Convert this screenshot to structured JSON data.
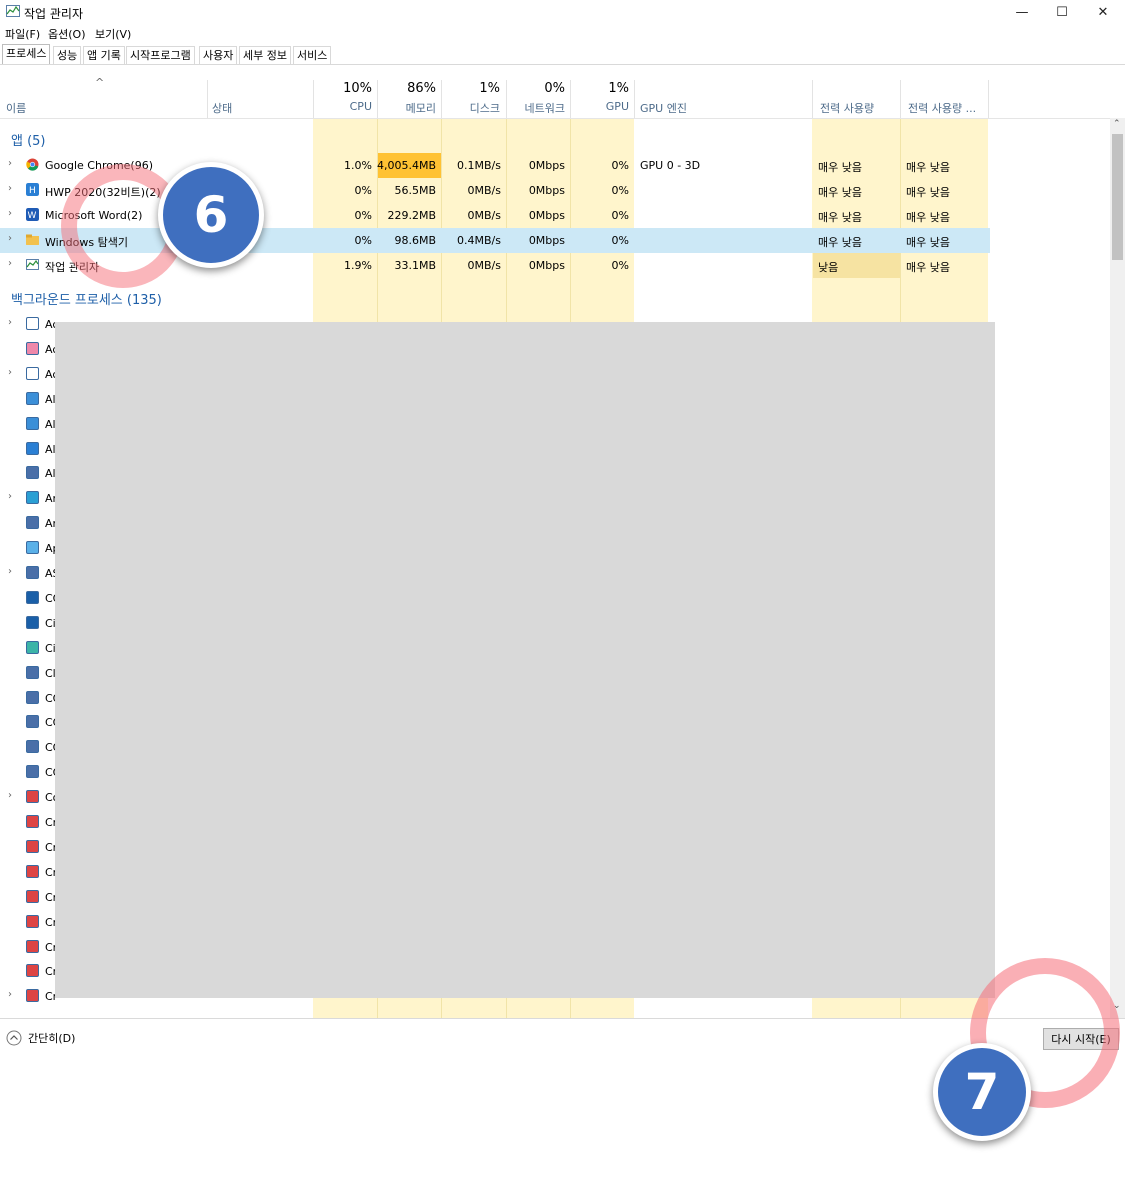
{
  "window": {
    "title": "작업 관리자",
    "minimize": "—",
    "maximize": "☐",
    "close": "✕"
  },
  "menu": [
    "파일(F)",
    "옵션(O)",
    "보기(V)"
  ],
  "tabs": [
    "프로세스",
    "성능",
    "앱 기록",
    "시작프로그램",
    "사용자",
    "세부 정보",
    "서비스"
  ],
  "columns": {
    "sort_arrow": "^",
    "name": "이름",
    "status": "상태",
    "cpu": {
      "pct": "10%",
      "label": "CPU"
    },
    "memory": {
      "pct": "86%",
      "label": "메모리"
    },
    "disk": {
      "pct": "1%",
      "label": "디스크"
    },
    "network": {
      "pct": "0%",
      "label": "네트워크"
    },
    "gpu": {
      "pct": "1%",
      "label": "GPU"
    },
    "gpu_engine": "GPU 엔진",
    "power": "전력 사용량",
    "power_trend": "전력 사용량 ..."
  },
  "groups": {
    "apps": "앱 (5)",
    "background": "백그라운드 프로세스 (135)"
  },
  "apps": [
    {
      "name": "Google Chrome(96)",
      "cpu": "1.0%",
      "mem": "4,005.4MB",
      "disk": "0.1MB/s",
      "net": "0Mbps",
      "gpu": "0%",
      "gpu_engine": "GPU 0 - 3D",
      "power": "매우 낮음",
      "power_trend": "매우 낮음"
    },
    {
      "name": "HWP 2020(32비트)(2)",
      "cpu": "0%",
      "mem": "56.5MB",
      "disk": "0MB/s",
      "net": "0Mbps",
      "gpu": "0%",
      "gpu_engine": "",
      "power": "매우 낮음",
      "power_trend": "매우 낮음"
    },
    {
      "name": "Microsoft Word(2)",
      "cpu": "0%",
      "mem": "229.2MB",
      "disk": "0MB/s",
      "net": "0Mbps",
      "gpu": "0%",
      "gpu_engine": "",
      "power": "매우 낮음",
      "power_trend": "매우 낮음"
    },
    {
      "name": "Windows 탐색기",
      "cpu": "0%",
      "mem": "98.6MB",
      "disk": "0.4MB/s",
      "net": "0Mbps",
      "gpu": "0%",
      "gpu_engine": "",
      "power": "매우 낮음",
      "power_trend": "매우 낮음"
    },
    {
      "name": "작업 관리자",
      "cpu": "1.9%",
      "mem": "33.1MB",
      "disk": "0MB/s",
      "net": "0Mbps",
      "gpu": "0%",
      "gpu_engine": "",
      "power": "낮음",
      "power_trend": "매우 낮음"
    }
  ],
  "background_rows": [
    "Ac",
    "Ac",
    "Ac",
    "Al",
    "Al",
    "Al",
    "Al",
    "Ar",
    "Ar",
    "Ap",
    "AS",
    "CO",
    "Ci",
    "Ci",
    "Cl",
    "CO",
    "CO",
    "CO",
    "CO",
    "Co",
    "Cr",
    "Cr",
    "Cr",
    "Cr",
    "Cr",
    "Cr",
    "Cr",
    "Cr"
  ],
  "footer": {
    "simple": "간단히(D)",
    "restart": "다시 시작(E)"
  },
  "callouts": {
    "step6": "6",
    "step7": "7"
  },
  "colors": {
    "accent": "#3f6fbf",
    "highlight": "#f56e78",
    "cpu_mem_heat": "#ffc233",
    "selected_row": "#cce8f6"
  }
}
